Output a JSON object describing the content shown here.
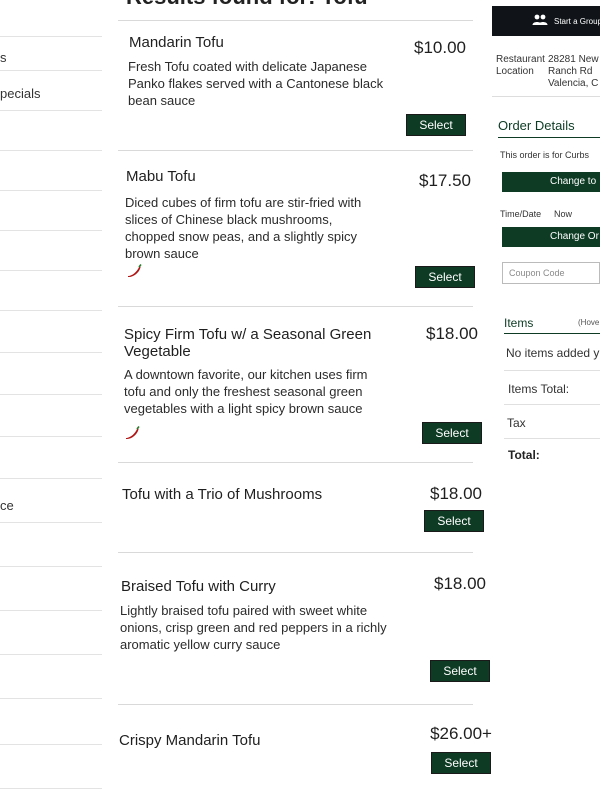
{
  "sidebar": {
    "items": [
      {
        "label": "s"
      },
      {
        "label": "pecials"
      },
      {
        "label": "ce"
      }
    ]
  },
  "results": {
    "heading": "Results found for: Tofu"
  },
  "menu": {
    "select_label": "Select",
    "items": [
      {
        "name": "Mandarin Tofu",
        "price": "$10.00",
        "description": "Fresh Tofu coated with delicate Japanese Panko flakes served with a Cantonese black bean sauce",
        "spicy": false
      },
      {
        "name": "Mabu Tofu",
        "price": "$17.50",
        "description": "Diced cubes of firm tofu are stir-fried with slices of Chinese black mushrooms, chopped snow peas, and a slightly spicy brown sauce",
        "spicy": true
      },
      {
        "name": "Spicy Firm Tofu w/ a Seasonal Green Vegetable",
        "price": "$18.00",
        "description": "A downtown favorite, our kitchen uses firm tofu and only the freshest seasonal green vegetables with a light spicy brown sauce",
        "spicy": true
      },
      {
        "name": "Tofu with a Trio of Mushrooms",
        "price": "$18.00",
        "description": "",
        "spicy": false
      },
      {
        "name": "Braised Tofu with Curry",
        "price": "$18.00",
        "description": "Lightly braised tofu paired with sweet white onions, crisp green and red peppers in a richly aromatic yellow curry sauce",
        "spicy": false
      },
      {
        "name": "Crispy Mandarin Tofu",
        "price": "$26.00+",
        "description": "",
        "spicy": false
      }
    ]
  },
  "order_panel": {
    "group_order_label": "Start a Group",
    "restaurant_label": "Restaurant Location",
    "restaurant_address": "28281 New\nRanch Rd\nValencia, C",
    "order_details_title": "Order Details",
    "order_for_text": "This order is for Curbs",
    "change_to_label": "Change to",
    "time_date_label": "Time/Date",
    "time_date_value": "Now",
    "change_order_label": "Change Or",
    "coupon_placeholder": "Coupon Code",
    "items_title": "Items",
    "hover_hint": "(Hove",
    "no_items_text": "No items added y",
    "items_total_label": "Items Total:",
    "tax_label": "Tax",
    "total_label": "Total:"
  },
  "colors": {
    "accent": "#0d3b24",
    "dark_bar": "#101418",
    "spicy": "#b01515"
  },
  "icons": {
    "spicy": "chili-pepper-icon",
    "group": "people-icon"
  }
}
